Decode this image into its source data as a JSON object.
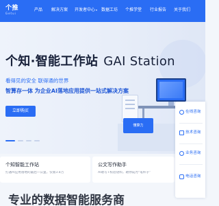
{
  "nav": {
    "logo_text": "个推",
    "logo_subtext": "Getui",
    "items": [
      {
        "label": "产品",
        "has_caret": false
      },
      {
        "label": "解决方案",
        "has_caret": false
      },
      {
        "label": "开发者中心",
        "has_caret": true
      },
      {
        "label": "数据工坊",
        "has_caret": false
      },
      {
        "label": "个推学堂",
        "has_caret": false
      },
      {
        "label": "行业报告",
        "has_caret": false
      },
      {
        "label": "关于我们",
        "has_caret": false
      }
    ]
  },
  "hero": {
    "title_cn": "个知·智能工作站",
    "title_en": "GAI Station",
    "tagline": "看得见的安全  联得通的世界",
    "subtitle": "智算存一体 为企业AI落地应用提供一站式解决方案",
    "cta_label": "立即购买",
    "screen_text": "懂算力",
    "carousel": {
      "total": 4,
      "active_index": 0
    }
  },
  "cards": [
    {
      "title": "个知智能工作站",
      "desc": "打通AI应用落地的最后一公里，仅需3.8万"
    },
    {
      "title": "公文写作助手",
      "desc": "AI助写+校验语料，助你成为“笔杆子”"
    }
  ],
  "section_heading": "专业的数据智能服务商",
  "float_panel": {
    "items": [
      {
        "label": "在线咨询",
        "icon": "chat-icon"
      },
      {
        "label": "技术咨询",
        "icon": "doc-icon"
      },
      {
        "label": "业务咨询",
        "icon": "headset-icon"
      },
      {
        "label": "电话咨询",
        "icon": "phone-icon"
      }
    ]
  },
  "colors": {
    "brand_blue": "#2a6df4",
    "hero_bg": "#eef3fb",
    "text_dark": "#18213a"
  }
}
